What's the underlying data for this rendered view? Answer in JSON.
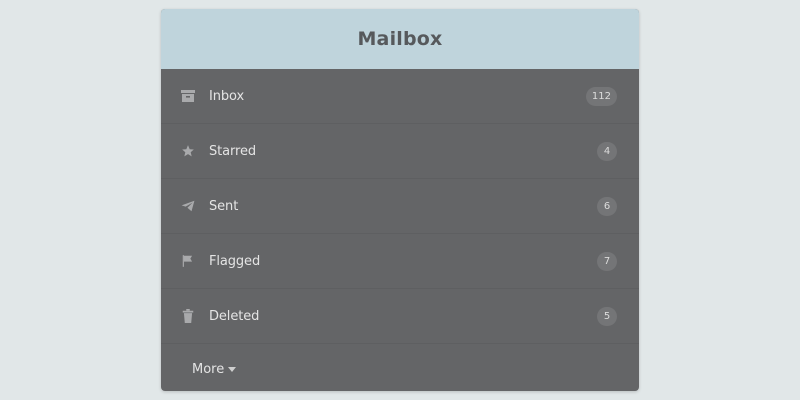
{
  "colors": {
    "background": "#e1e7e8",
    "header_bg": "#bfd4dc",
    "panel_bg": "#646567",
    "badge_bg": "#747577",
    "text": "#e4e4e4",
    "title": "#56595c"
  },
  "header": {
    "title": "Mailbox"
  },
  "menu": {
    "items": [
      {
        "label": "Inbox",
        "count": "112",
        "icon": "inbox-icon"
      },
      {
        "label": "Starred",
        "count": "4",
        "icon": "star-icon"
      },
      {
        "label": "Sent",
        "count": "6",
        "icon": "paper-plane-icon"
      },
      {
        "label": "Flagged",
        "count": "7",
        "icon": "flag-icon"
      },
      {
        "label": "Deleted",
        "count": "5",
        "icon": "trash-icon"
      }
    ],
    "more_label": "More"
  }
}
